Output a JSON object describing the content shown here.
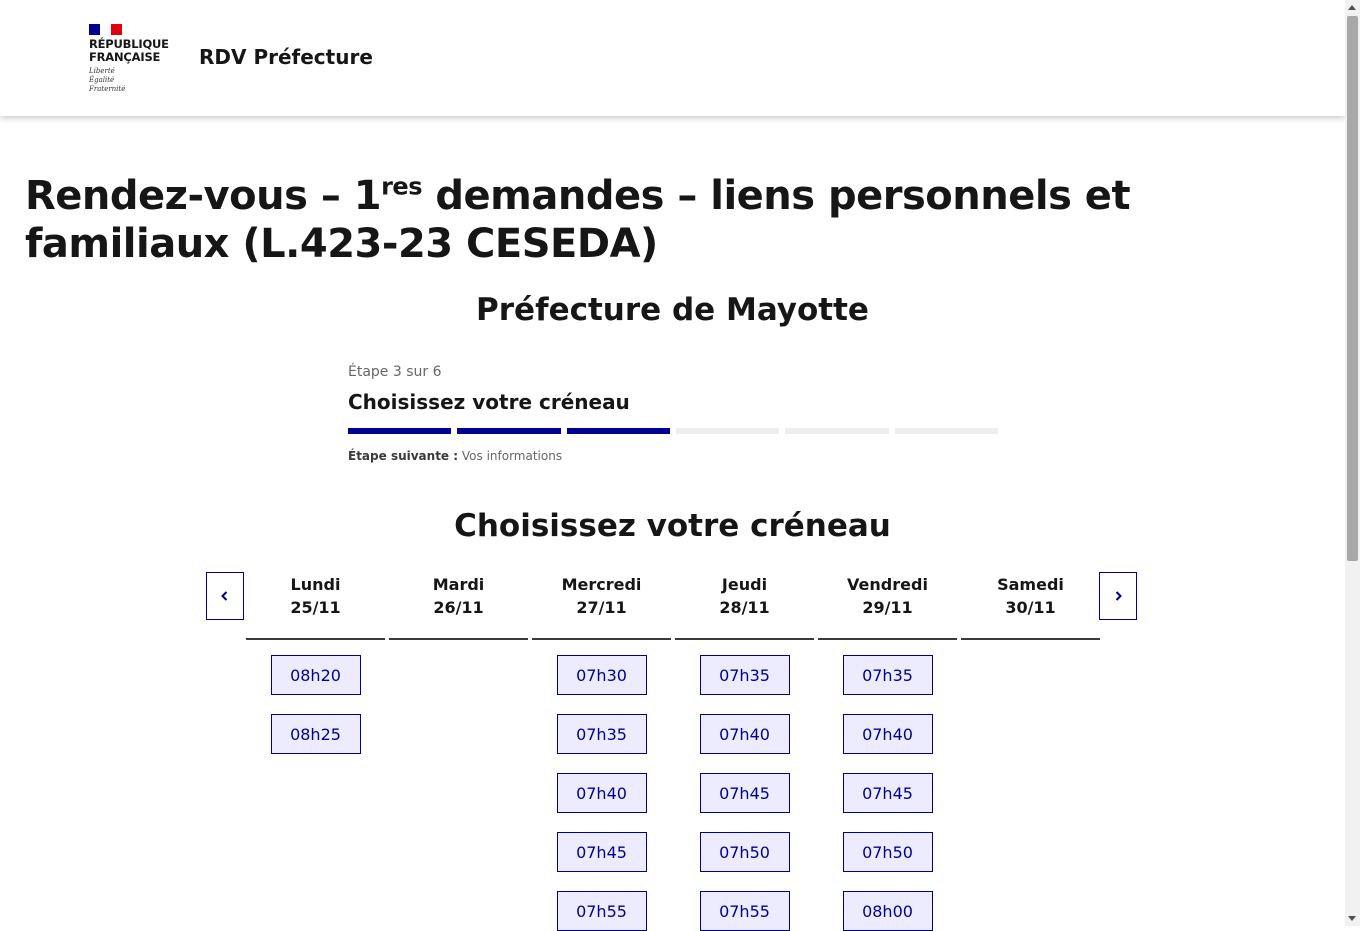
{
  "header": {
    "logo": {
      "name_line1": "RÉPUBLIQUE",
      "name_line2": "FRANÇAISE",
      "motto_line1": "Liberté",
      "motto_line2": "Égalité",
      "motto_line3": "Fraternité",
      "flag_colors": [
        "#000091",
        "#ffffff",
        "#e1000f"
      ]
    },
    "site_title": "RDV Préfecture"
  },
  "page": {
    "title_before": "Rendez-vous – 1",
    "title_sup": "res",
    "title_after": " demandes – liens personnels et familiaux (L.423-23 CESEDA)",
    "prefecture": "Préfecture de Mayotte"
  },
  "stepper": {
    "count": "Étape 3 sur 6",
    "title": "Choisissez votre créneau",
    "total_steps": 6,
    "current_step": 3,
    "next_label": "Étape suivante :",
    "next_value": "Vos informations"
  },
  "calendar": {
    "section_title": "Choisissez votre créneau",
    "prev_icon": "chevron-left-icon",
    "next_icon": "chevron-right-icon",
    "days": [
      {
        "name": "Lundi",
        "date": "25/11",
        "slots": [
          "08h20",
          "08h25"
        ]
      },
      {
        "name": "Mardi",
        "date": "26/11",
        "slots": []
      },
      {
        "name": "Mercredi",
        "date": "27/11",
        "slots": [
          "07h30",
          "07h35",
          "07h40",
          "07h45",
          "07h55"
        ]
      },
      {
        "name": "Jeudi",
        "date": "28/11",
        "slots": [
          "07h35",
          "07h40",
          "07h45",
          "07h50",
          "07h55"
        ]
      },
      {
        "name": "Vendredi",
        "date": "29/11",
        "slots": [
          "07h35",
          "07h40",
          "07h45",
          "07h50",
          "08h00"
        ]
      },
      {
        "name": "Samedi",
        "date": "30/11",
        "slots": []
      }
    ]
  },
  "colors": {
    "accent": "#000091",
    "slot_bg": "#ececfe",
    "step_inactive": "#eeeeee"
  }
}
